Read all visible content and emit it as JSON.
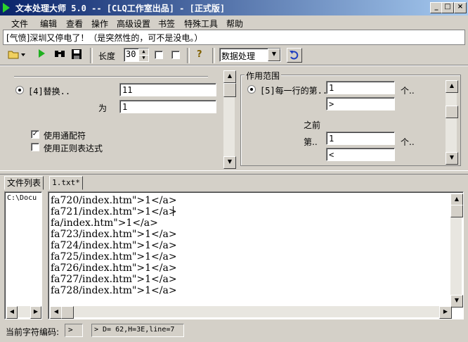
{
  "window": {
    "title": "文本处理大师 5.0 -- [CLQ工作室出品] - [正式版]",
    "min": "_",
    "max": "□",
    "close": "×"
  },
  "menu": [
    "文件",
    "编辑",
    "查看",
    "操作",
    "高级设置",
    "书签",
    "特殊工具",
    "帮助"
  ],
  "message": "[气愤]深圳又停电了！（是突然性的，可不是没电。）",
  "toolbar": {
    "length_label": "长度",
    "length_value": "30",
    "help_glyph": "?",
    "mode_select": "数据处理"
  },
  "left_panel": {
    "replace_label": "[4]替换..",
    "replace_value": "11",
    "with_label": "为",
    "with_value": "1",
    "wildcard_label": "使用通配符",
    "wildcard_checked": "✓",
    "regex_label": "使用正则表达式"
  },
  "scope": {
    "title": "作用范围",
    "each_line_label": "[5]每一行的第..",
    "each_line_value": "1",
    "unit1": "个..",
    "after_value": ">",
    "before_label": "之前",
    "nth_label": "第..",
    "nth_value": "1",
    "unit2": "个..",
    "before_value": "<"
  },
  "tabs": {
    "file_list": "文件列表",
    "doc": "1.txt*"
  },
  "file_tree": {
    "item": "C:\\Docu"
  },
  "editor": {
    "lines": [
      "fa720/index.htm\">1</a>",
      "fa721/index.htm\">1</a>",
      "fa/index.htm\">1</a>",
      "fa723/index.htm\">1</a>",
      "fa724/index.htm\">1</a>",
      "fa725/index.htm\">1</a>",
      "fa726/index.htm\">1</a>",
      "fa727/index.htm\">1</a>",
      "fa728/index.htm\">1</a>"
    ]
  },
  "status": {
    "encoding_label": "当前字符编码:",
    "encoding_value": ">",
    "info": "> D= 62,H=3E,line=7"
  }
}
